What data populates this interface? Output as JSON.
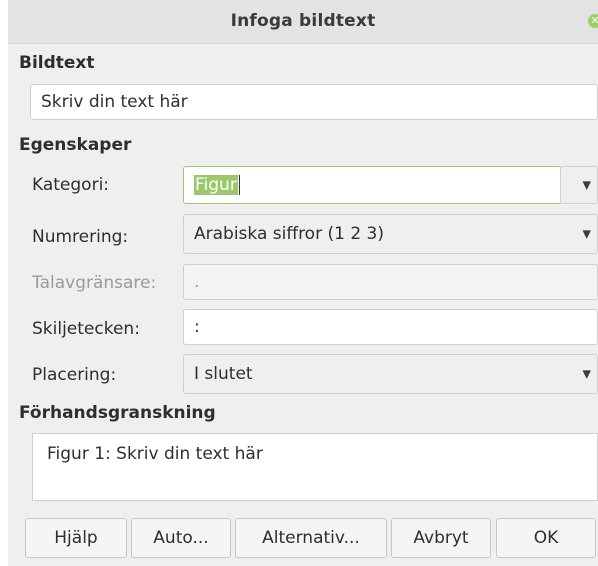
{
  "window": {
    "title": "Infoga bildtext",
    "close_icon": "close-icon"
  },
  "caption": {
    "heading": "Bildtext",
    "text": "Skriv din text här"
  },
  "properties": {
    "heading": "Egenskaper",
    "category": {
      "label": "Kategori:",
      "value": "Figur"
    },
    "numbering": {
      "label": "Numrering:",
      "value": "Arabiska siffror (1 2 3)"
    },
    "separator_level": {
      "label": "Talavgränsare:",
      "value": "."
    },
    "separator": {
      "label": "Skiljetecken:",
      "value": ":"
    },
    "position": {
      "label": "Placering:",
      "value": "I slutet"
    }
  },
  "preview": {
    "heading": "Förhandsgranskning",
    "text": "Figur 1: Skriv din text här"
  },
  "buttons": {
    "help": "Hjälp",
    "auto": "Auto...",
    "options": "Alternativ...",
    "cancel": "Avbryt",
    "ok": "OK"
  },
  "colors": {
    "accent": "#9bc86b"
  }
}
